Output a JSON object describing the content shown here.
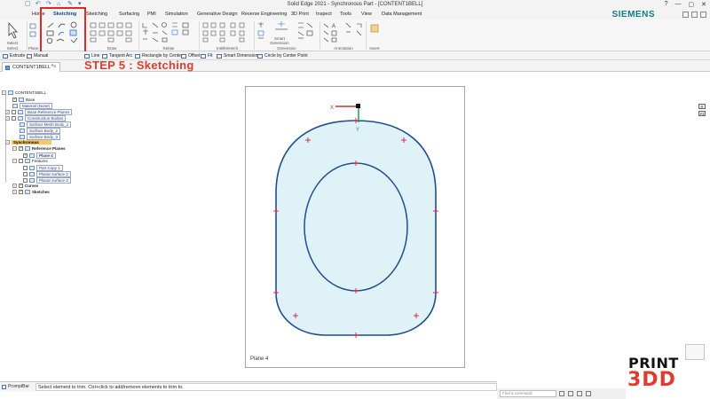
{
  "window": {
    "title": "Solid Edge 2021 - Synchronous Part - [CONTENT1BELL]",
    "controls": [
      "?",
      "—",
      "▢",
      "✕"
    ]
  },
  "quick_access": [
    "▢",
    "↶",
    "↷",
    "⌂",
    "✎",
    "▾"
  ],
  "ribbon_tabs": [
    "Home",
    "Sketching",
    "Sketching",
    "Surfacing",
    "PMI",
    "Simulation",
    "Generative Design",
    "Reverse Engineering",
    "3D Print",
    "Inspect",
    "Tools",
    "View",
    "Data Management"
  ],
  "brand": "SIEMENS",
  "ribbon_groups": {
    "select_btn": "Select",
    "select": "Select",
    "plane": "Plane",
    "draw": "Draw",
    "relate": "Relate",
    "intellisketch": "IntelliSketch",
    "smart_dimension": "Smart Dimension",
    "dimension": "Dimension",
    "annotation": "Annotation",
    "insert": "Insert"
  },
  "command_bar": [
    {
      "label": "Extrude"
    },
    {
      "label": "Manual"
    },
    {
      "label": "Line"
    },
    {
      "label": "Tangent Arc"
    },
    {
      "label": "Rectangle by Center"
    },
    {
      "label": "Offset"
    },
    {
      "label": "Fit"
    },
    {
      "label": "Smart Dimension"
    },
    {
      "label": "Circle by Center Point"
    }
  ],
  "step_caption": "STEP 5 : Sketching",
  "doc_tab": {
    "label": "CONTENT1BELL",
    "close": "×",
    "add": "+"
  },
  "tree": {
    "root": "CONTENT1BELL",
    "base": "Base",
    "material": "Material (None)",
    "base_ref_planes": "Base Reference Planes",
    "construction_bodies": "Construction Bodies",
    "surface_mesh_body": "Surface Mesh Body_1",
    "surface_body_2": "Surface Body_2",
    "surface_body_3": "Surface Body_3",
    "synchronous": "Synchronous",
    "reference_planes": "Reference Planes",
    "plane_4": "Plane 4",
    "features": "Features",
    "part_copy": "Part Copy 1",
    "planar_surface_2": "Planar surface 2",
    "planar_surface_3": "Planar surface 3",
    "curves": "Curves",
    "sketches": "Sketches"
  },
  "canvas": {
    "plane_label": "Plane 4",
    "axis_x": "X",
    "axis_y": "Y",
    "fill_color": "#dff2f8",
    "stroke_color": "#1f4e8c",
    "marker_color": "#d81b3c"
  },
  "right_tools": [
    "⌾",
    "F3"
  ],
  "prompt_bar": {
    "tab_label": "PromptBar",
    "message": "Select element to trim. Ctrl+click to add/remove elements to trim to."
  },
  "status": {
    "find_placeholder": "Find a command"
  },
  "logo": {
    "top": "PRINT",
    "bottom": "3DD"
  }
}
